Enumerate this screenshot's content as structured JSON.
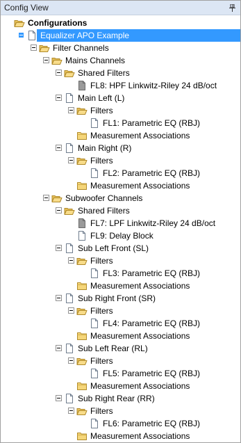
{
  "panel": {
    "title": "Config View",
    "pin_icon": "pin-icon"
  },
  "tree": [
    {
      "label": "Configurations",
      "depth": 0,
      "icon": "folder-open",
      "expander": false,
      "bold": true,
      "selected": false
    },
    {
      "label": "Equalizer APO Example",
      "depth": 1,
      "icon": "document",
      "expander": true,
      "bold": false,
      "selected": true
    },
    {
      "label": "Filter Channels",
      "depth": 2,
      "icon": "folder-open",
      "expander": true,
      "bold": false,
      "selected": false
    },
    {
      "label": "Mains Channels",
      "depth": 3,
      "icon": "folder-open",
      "expander": true,
      "bold": false,
      "selected": false
    },
    {
      "label": "Shared Filters",
      "depth": 4,
      "icon": "folder-open",
      "expander": true,
      "bold": false,
      "selected": false
    },
    {
      "label": "FL8: HPF Linkwitz-Riley 24 dB/oct",
      "depth": 5,
      "icon": "document-gray",
      "expander": false,
      "bold": false,
      "selected": false
    },
    {
      "label": "Main Left (L)",
      "depth": 4,
      "icon": "document",
      "expander": true,
      "bold": false,
      "selected": false
    },
    {
      "label": "Filters",
      "depth": 5,
      "icon": "folder-open",
      "expander": true,
      "bold": false,
      "selected": false
    },
    {
      "label": "FL1: Parametric EQ (RBJ)",
      "depth": 6,
      "icon": "document",
      "expander": false,
      "bold": false,
      "selected": false
    },
    {
      "label": "Measurement Associations",
      "depth": 5,
      "icon": "folder",
      "expander": false,
      "bold": false,
      "selected": false
    },
    {
      "label": "Main Right (R)",
      "depth": 4,
      "icon": "document",
      "expander": true,
      "bold": false,
      "selected": false
    },
    {
      "label": "Filters",
      "depth": 5,
      "icon": "folder-open",
      "expander": true,
      "bold": false,
      "selected": false
    },
    {
      "label": "FL2: Parametric EQ (RBJ)",
      "depth": 6,
      "icon": "document",
      "expander": false,
      "bold": false,
      "selected": false
    },
    {
      "label": "Measurement Associations",
      "depth": 5,
      "icon": "folder",
      "expander": false,
      "bold": false,
      "selected": false
    },
    {
      "label": "Subwoofer Channels",
      "depth": 3,
      "icon": "folder-open",
      "expander": true,
      "bold": false,
      "selected": false
    },
    {
      "label": "Shared Filters",
      "depth": 4,
      "icon": "folder-open",
      "expander": true,
      "bold": false,
      "selected": false
    },
    {
      "label": "FL7: LPF Linkwitz-Riley 24 dB/oct",
      "depth": 5,
      "icon": "document-gray",
      "expander": false,
      "bold": false,
      "selected": false
    },
    {
      "label": "FL9: Delay Block",
      "depth": 5,
      "icon": "document",
      "expander": false,
      "bold": false,
      "selected": false
    },
    {
      "label": "Sub Left Front (SL)",
      "depth": 4,
      "icon": "document",
      "expander": true,
      "bold": false,
      "selected": false
    },
    {
      "label": "Filters",
      "depth": 5,
      "icon": "folder-open",
      "expander": true,
      "bold": false,
      "selected": false
    },
    {
      "label": "FL3: Parametric EQ (RBJ)",
      "depth": 6,
      "icon": "document",
      "expander": false,
      "bold": false,
      "selected": false
    },
    {
      "label": "Measurement Associations",
      "depth": 5,
      "icon": "folder",
      "expander": false,
      "bold": false,
      "selected": false
    },
    {
      "label": "Sub Right Front (SR)",
      "depth": 4,
      "icon": "document",
      "expander": true,
      "bold": false,
      "selected": false
    },
    {
      "label": "Filters",
      "depth": 5,
      "icon": "folder-open",
      "expander": true,
      "bold": false,
      "selected": false
    },
    {
      "label": "FL4: Parametric EQ (RBJ)",
      "depth": 6,
      "icon": "document",
      "expander": false,
      "bold": false,
      "selected": false
    },
    {
      "label": "Measurement Associations",
      "depth": 5,
      "icon": "folder",
      "expander": false,
      "bold": false,
      "selected": false
    },
    {
      "label": "Sub Left Rear (RL)",
      "depth": 4,
      "icon": "document",
      "expander": true,
      "bold": false,
      "selected": false
    },
    {
      "label": "Filters",
      "depth": 5,
      "icon": "folder-open",
      "expander": true,
      "bold": false,
      "selected": false
    },
    {
      "label": "FL5: Parametric EQ (RBJ)",
      "depth": 6,
      "icon": "document",
      "expander": false,
      "bold": false,
      "selected": false
    },
    {
      "label": "Measurement Associations",
      "depth": 5,
      "icon": "folder",
      "expander": false,
      "bold": false,
      "selected": false
    },
    {
      "label": "Sub Right Rear (RR)",
      "depth": 4,
      "icon": "document",
      "expander": true,
      "bold": false,
      "selected": false
    },
    {
      "label": "Filters",
      "depth": 5,
      "icon": "folder-open",
      "expander": true,
      "bold": false,
      "selected": false
    },
    {
      "label": "FL6: Parametric EQ (RBJ)",
      "depth": 6,
      "icon": "document",
      "expander": false,
      "bold": false,
      "selected": false
    },
    {
      "label": "Measurement Associations",
      "depth": 5,
      "icon": "folder",
      "expander": false,
      "bold": false,
      "selected": false
    }
  ],
  "colors": {
    "selection": "#3399ff",
    "titlebar": "#dce6f4",
    "folder": "#f5d67a"
  }
}
